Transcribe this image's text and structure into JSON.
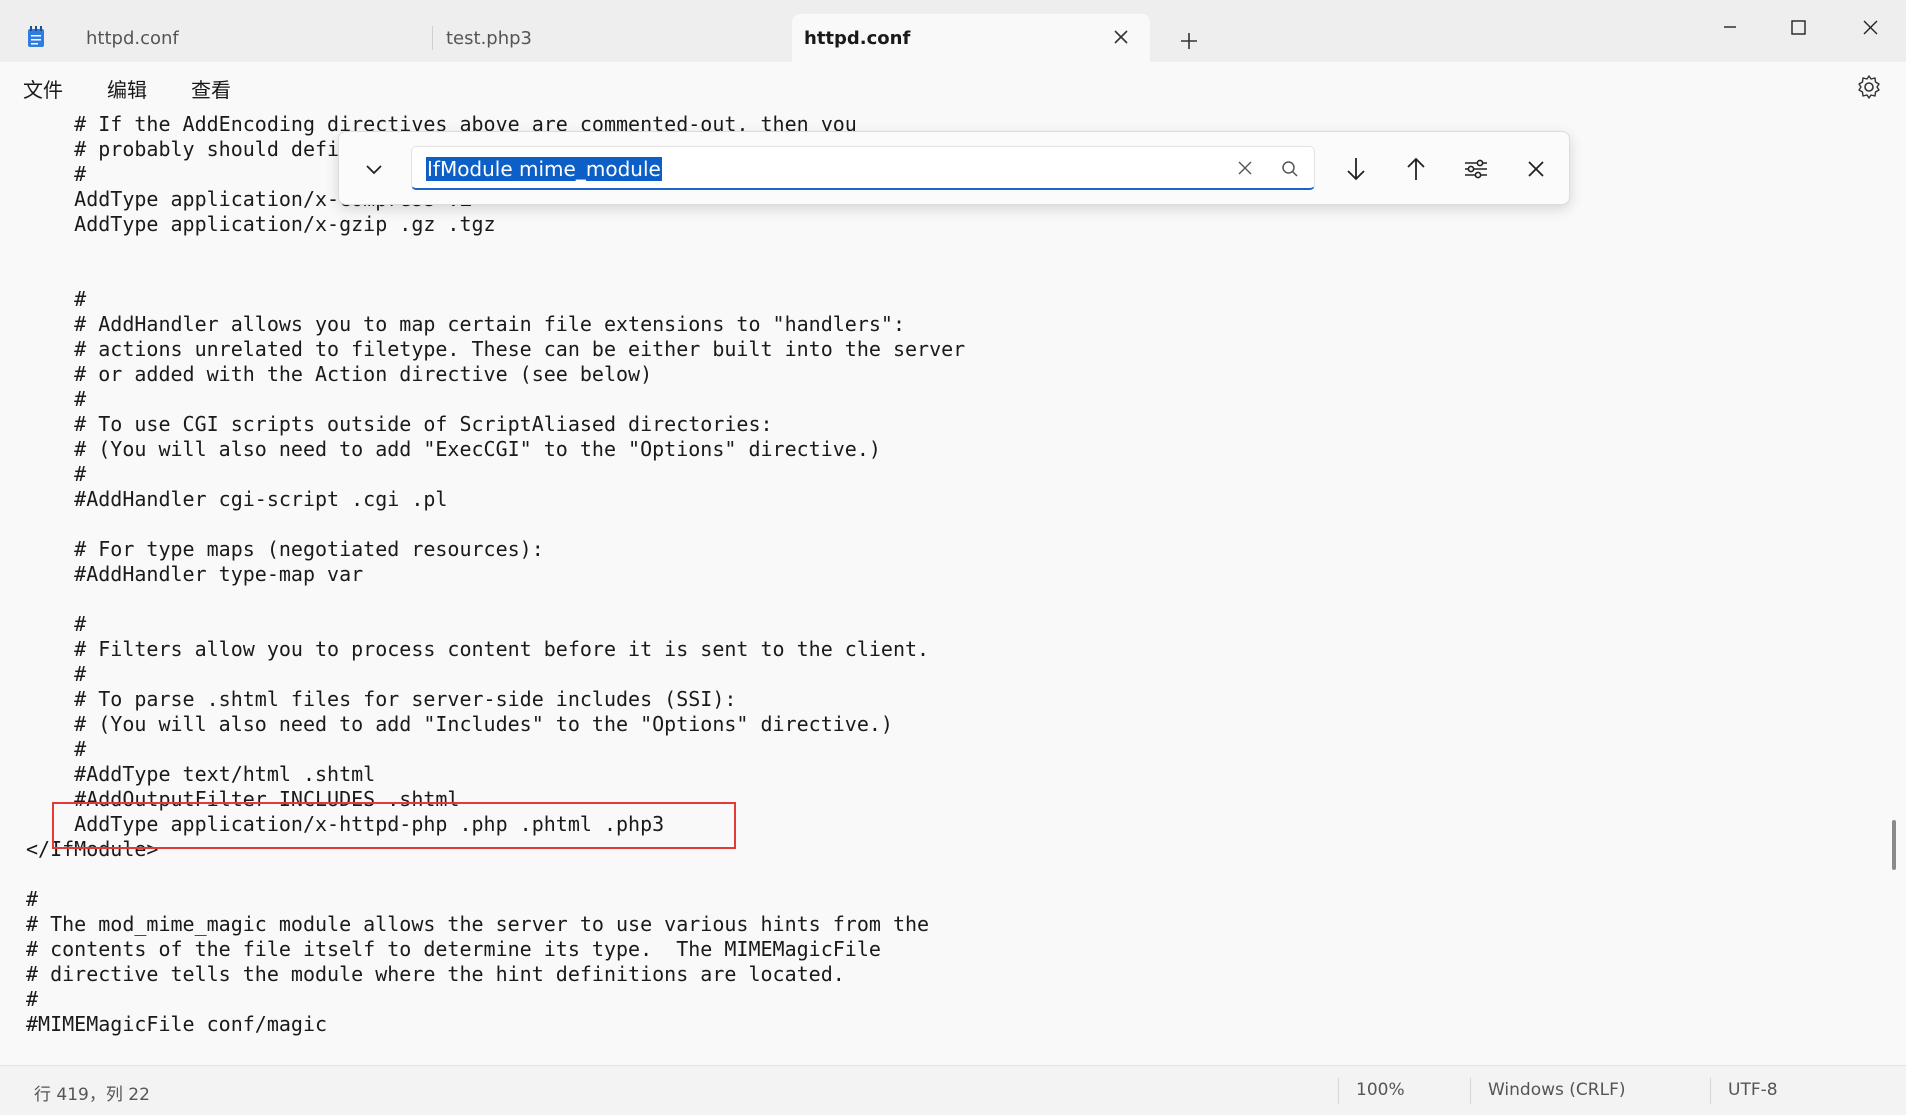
{
  "tabs": [
    {
      "label": "httpd.conf",
      "active": false
    },
    {
      "label": "test.php3",
      "active": false
    },
    {
      "label": "httpd.conf",
      "active": true
    }
  ],
  "menu": [
    "文件",
    "编辑",
    "查看"
  ],
  "find": {
    "value": "IfModule mime_module"
  },
  "editor": {
    "lines": [
      "    # If the AddEncoding directives above are commented-out, then you",
      "    # probably should define those extensions to indicate media types:",
      "    #",
      "    AddType application/x-compress .Z",
      "    AddType application/x-gzip .gz .tgz",
      "",
      "",
      "    #",
      "    # AddHandler allows you to map certain file extensions to \"handlers\":",
      "    # actions unrelated to filetype. These can be either built into the server",
      "    # or added with the Action directive (see below)",
      "    #",
      "    # To use CGI scripts outside of ScriptAliased directories:",
      "    # (You will also need to add \"ExecCGI\" to the \"Options\" directive.)",
      "    #",
      "    #AddHandler cgi-script .cgi .pl",
      "",
      "    # For type maps (negotiated resources):",
      "    #AddHandler type-map var",
      "",
      "    #",
      "    # Filters allow you to process content before it is sent to the client.",
      "    #",
      "    # To parse .shtml files for server-side includes (SSI):",
      "    # (You will also need to add \"Includes\" to the \"Options\" directive.)",
      "    #",
      "    #AddType text/html .shtml",
      "    #AddOutputFilter INCLUDES .shtml",
      "    AddType application/x-httpd-php .php .phtml .php3",
      "</IfModule>",
      "",
      "#",
      "# The mod_mime_magic module allows the server to use various hints from the",
      "# contents of the file itself to determine its type.  The MIMEMagicFile",
      "# directive tells the module where the hint definitions are located.",
      "#",
      "#MIMEMagicFile conf/magic"
    ]
  },
  "status": {
    "position": "行 419，列 22",
    "zoom": "100%",
    "line_ending": "Windows (CRLF)",
    "encoding": "UTF-8"
  },
  "colors": {
    "accent": "#0b5fc7",
    "highlight_box": "#e53935"
  }
}
